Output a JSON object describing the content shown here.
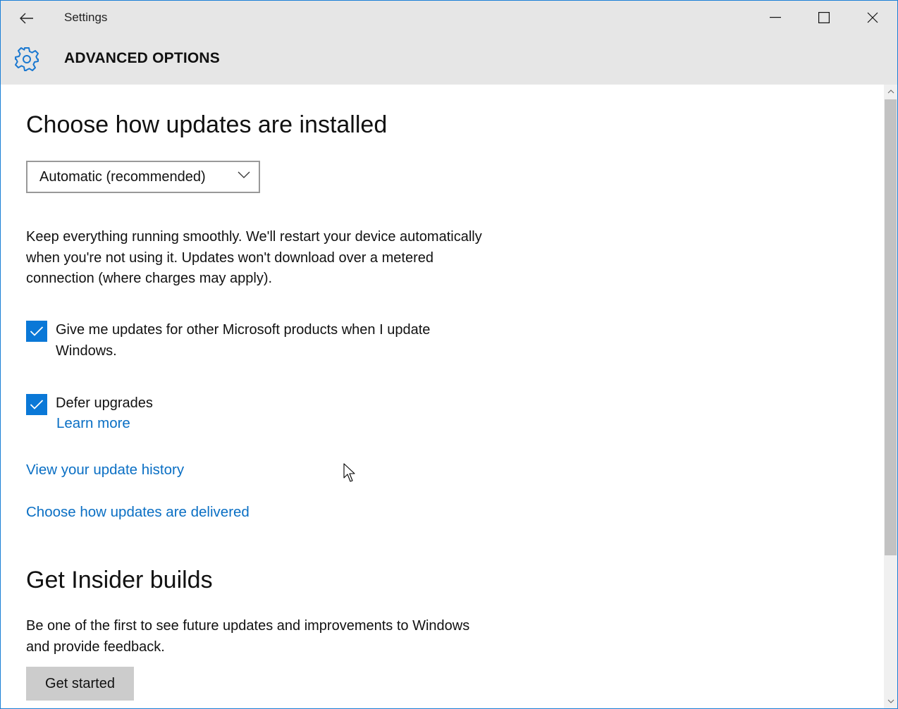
{
  "window": {
    "app_title": "Settings",
    "back_icon": "back-arrow-icon",
    "controls": {
      "minimize": "minimize-icon",
      "maximize": "maximize-icon",
      "close": "close-icon"
    },
    "accent_color": "#0a78d7"
  },
  "header": {
    "icon": "gear-icon",
    "title": "ADVANCED OPTIONS"
  },
  "main": {
    "install_section": {
      "heading": "Choose how updates are installed",
      "dropdown_value": "Automatic (recommended)",
      "description": "Keep everything running smoothly. We'll restart your device automatically when you're not using it. Updates won't download over a metered connection (where charges may apply)."
    },
    "checkboxes": [
      {
        "label": "Give me updates for other Microsoft products when I update Windows.",
        "checked": true
      },
      {
        "label": "Defer upgrades",
        "checked": true
      }
    ],
    "learn_more_link": "Learn more",
    "links": {
      "update_history": "View your update history",
      "delivery": "Choose how updates are delivered"
    },
    "insider_section": {
      "heading": "Get Insider builds",
      "description": "Be one of the first to see future updates and improvements to Windows and provide feedback.",
      "button_label": "Get started"
    }
  },
  "scrollbar": {
    "up_icon": "chevron-up-icon",
    "down_icon": "chevron-down-icon"
  }
}
